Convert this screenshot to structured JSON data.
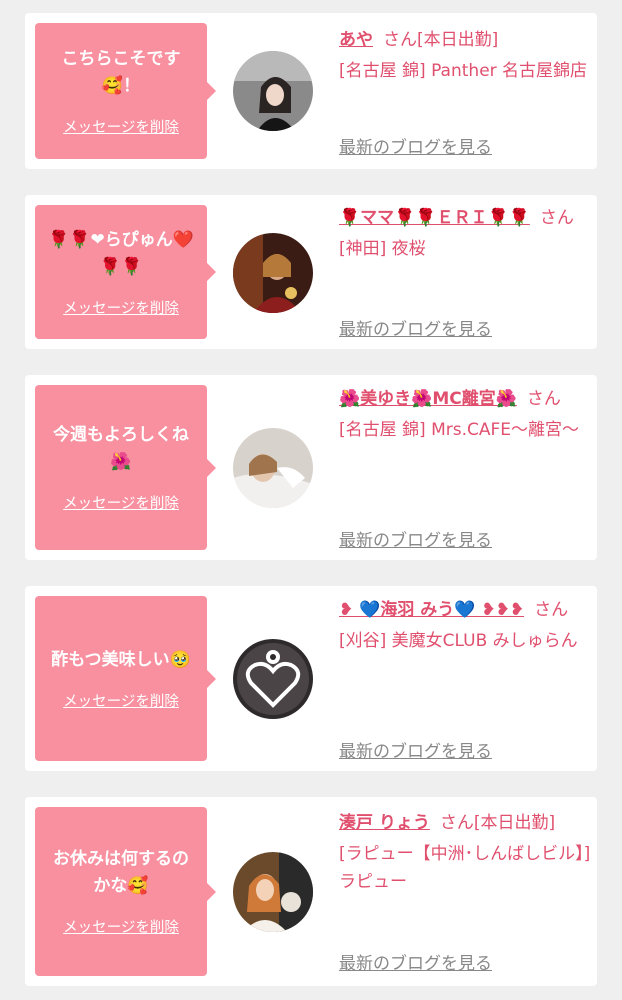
{
  "colors": {
    "background": "#efefef",
    "card": "#ffffff",
    "bubble": "#f990a0",
    "accent": "#e0506e",
    "link_gray": "#888888"
  },
  "delete_label": "メッセージを削除",
  "blog_label": "最新のブログを見る",
  "items": [
    {
      "message": "こちらこそです🥰！",
      "name": "あや",
      "honorific": "さん",
      "status": "[本日出勤]",
      "shop": "[名古屋 錦] Panther 名古屋錦店"
    },
    {
      "message": "🌹🌹❤らぴゅん❤️🌹🌹",
      "name": "🌹ママ🌹🌹ＥＲＩ🌹🌹",
      "honorific": "さん",
      "status": "",
      "shop": "[神田] 夜桜"
    },
    {
      "message": "今週もよろしくね🌺",
      "name": "🌺美ゆき🌺MC離宮🌺",
      "honorific": "さん",
      "status": "",
      "shop": "[名古屋 錦] Mrs.CAFE〜離宮〜"
    },
    {
      "message": "酢もつ美味しい🥹",
      "name": "❥ 💙海羽 みう💙 ❥❥❥",
      "honorific": "さん",
      "status": "",
      "shop": "[刈谷] 美魔女CLUB みしゅらん"
    },
    {
      "message": "お休みは何するのかな🥰",
      "name": "湊戸 りょう",
      "honorific": "さん",
      "status": "[本日出勤]",
      "shop": "[ラピュー【中洲･しんばしビル】] ラピュー"
    }
  ]
}
